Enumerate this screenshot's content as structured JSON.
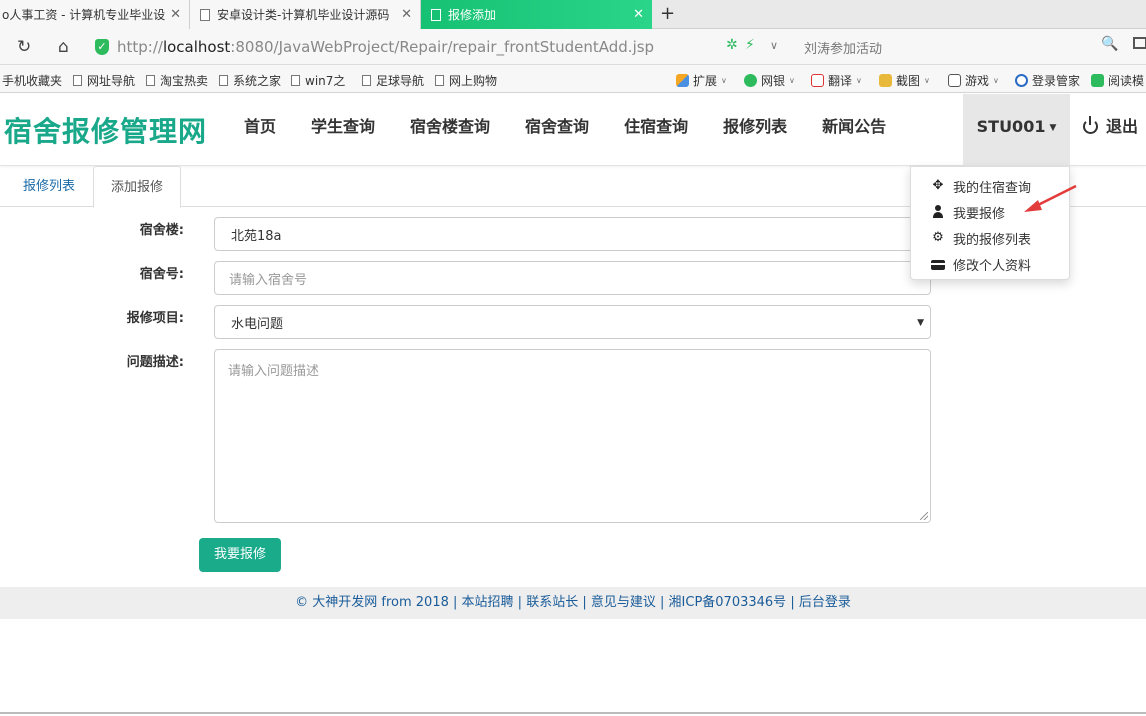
{
  "browser": {
    "tabs": [
      {
        "title": "o人事工资 - 计算机专业毕业设",
        "active": false
      },
      {
        "title": "安卓设计类-计算机毕业设计源码",
        "active": false
      },
      {
        "title": "报修添加",
        "active": true
      }
    ],
    "new_tab": "+",
    "url_prefix": "http://",
    "url_host": "localhost",
    "url_rest": ":8080/JavaWebProject/Repair/repair_frontStudentAdd.jsp",
    "search_hint": "刘涛参加活动",
    "bookmarks": [
      "手机收藏夹",
      "网址导航",
      "淘宝热卖",
      "系统之家",
      "win7之",
      "足球导航",
      "网上购物"
    ],
    "extensions": [
      "扩展",
      "网银",
      "翻译",
      "截图",
      "游戏",
      "登录管家",
      "阅读模"
    ]
  },
  "site": {
    "brand": "宿舍报修管理网",
    "nav": [
      "首页",
      "学生查询",
      "宿舍楼查询",
      "宿舍查询",
      "住宿查询",
      "报修列表",
      "新闻公告"
    ],
    "user": "STU001",
    "logout": "退出"
  },
  "tabs": {
    "list": "报修列表",
    "add": "添加报修"
  },
  "form": {
    "building_label": "宿舍楼:",
    "building_value": "北苑18a",
    "room_label": "宿舍号:",
    "room_placeholder": "请输入宿舍号",
    "item_label": "报修项目:",
    "item_value": "水电问题",
    "desc_label": "问题描述:",
    "desc_placeholder": "请输入问题描述",
    "submit": "我要报修"
  },
  "dropdown": [
    "我的住宿查询",
    "我要报修",
    "我的报修列表",
    "修改个人资料"
  ],
  "footer": {
    "copyright": "© 大神开发网 from 2018",
    "links": [
      "本站招聘",
      "联系站长",
      "意见与建议",
      "湘ICP备0703346号",
      "后台登录"
    ]
  },
  "colors": {
    "brand": "#1aa88a",
    "button": "#1aab8b",
    "active_tab": "#16c173",
    "link": "#1a5c99"
  }
}
